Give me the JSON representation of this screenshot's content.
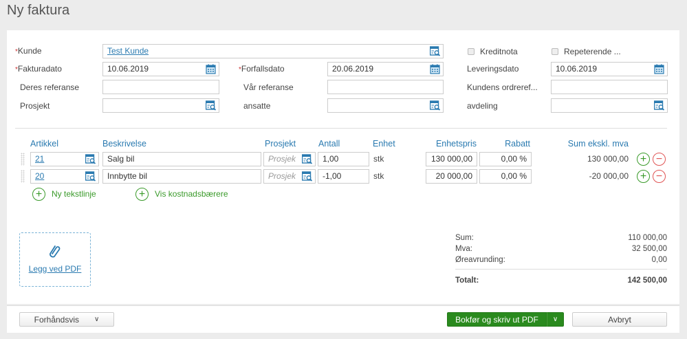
{
  "title": "Ny faktura",
  "form": {
    "kunde_label": "Kunde",
    "kunde_value": "Test Kunde",
    "kreditnota_label": "Kreditnota",
    "repeterende_label": "Repeterende ...",
    "fakturadato_label": "Fakturadato",
    "fakturadato_value": "10.06.2019",
    "forfallsdato_label": "Forfallsdato",
    "forfallsdato_value": "20.06.2019",
    "leveringsdato_label": "Leveringsdato",
    "leveringsdato_value": "10.06.2019",
    "deres_ref_label": "Deres referanse",
    "var_ref_label": "Vår referanse",
    "kundens_ordreref_label": "Kundens ordreref...",
    "prosjekt_label": "Prosjekt",
    "ansatte_label": "ansatte",
    "avdeling_label": "avdeling"
  },
  "table": {
    "headers": {
      "artikel": "Artikkel",
      "beskrivelse": "Beskrivelse",
      "prosjekt": "Prosjekt",
      "antall": "Antall",
      "enhet": "Enhet",
      "enhetspris": "Enhetspris",
      "rabatt": "Rabatt",
      "sum": "Sum ekskl. mva"
    },
    "rows": [
      {
        "artikel": "21",
        "beskrivelse": "Salg bil",
        "prosjekt_placeholder": "Prosjek",
        "antall": "1,00",
        "enhet": "stk",
        "enhetspris": "130 000,00",
        "rabatt": "0,00 %",
        "sum": "130 000,00"
      },
      {
        "artikel": "20",
        "beskrivelse": "Innbytte bil",
        "prosjekt_placeholder": "Prosjek",
        "antall": "-1,00",
        "enhet": "stk",
        "enhetspris": "20 000,00",
        "rabatt": "0,00 %",
        "sum": "-20 000,00"
      }
    ],
    "add_text_line": "Ny tekstlinje",
    "show_cost_carriers": "Vis kostnadsbærere"
  },
  "attach": {
    "label": "Legg ved PDF"
  },
  "totals": {
    "sum_label": "Sum:",
    "sum": "110 000,00",
    "mva_label": "Mva:",
    "mva": "32 500,00",
    "rounding_label": "Øreavrunding:",
    "rounding": "0,00",
    "total_label": "Totalt:",
    "total": "142 500,00"
  },
  "footer": {
    "preview": "Forhåndsvis",
    "post": "Bokfør og skriv ut PDF",
    "cancel": "Avbryt"
  },
  "colors": {
    "accent": "#2a7ab0",
    "primary_button": "#2a8a1e",
    "required": "#cc3333"
  }
}
